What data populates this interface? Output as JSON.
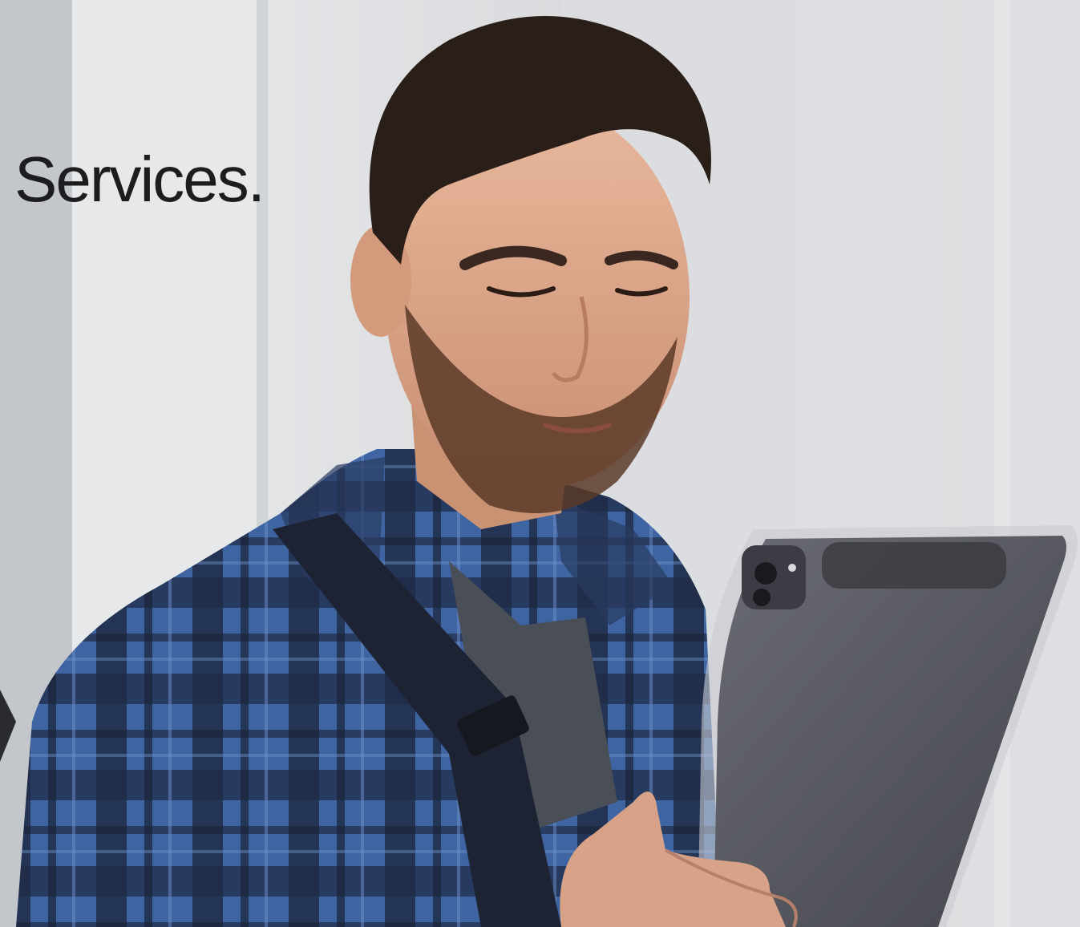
{
  "hero": {
    "title": "Services.",
    "image": {
      "subject": "photo-person-with-tablet"
    }
  },
  "colors": {
    "title_text": "#1d1d1f",
    "background": "#d9dcde",
    "shirt_blue": "#3a5f9a",
    "shirt_navy": "#1c2840",
    "tablet_gray": "#55565e"
  }
}
